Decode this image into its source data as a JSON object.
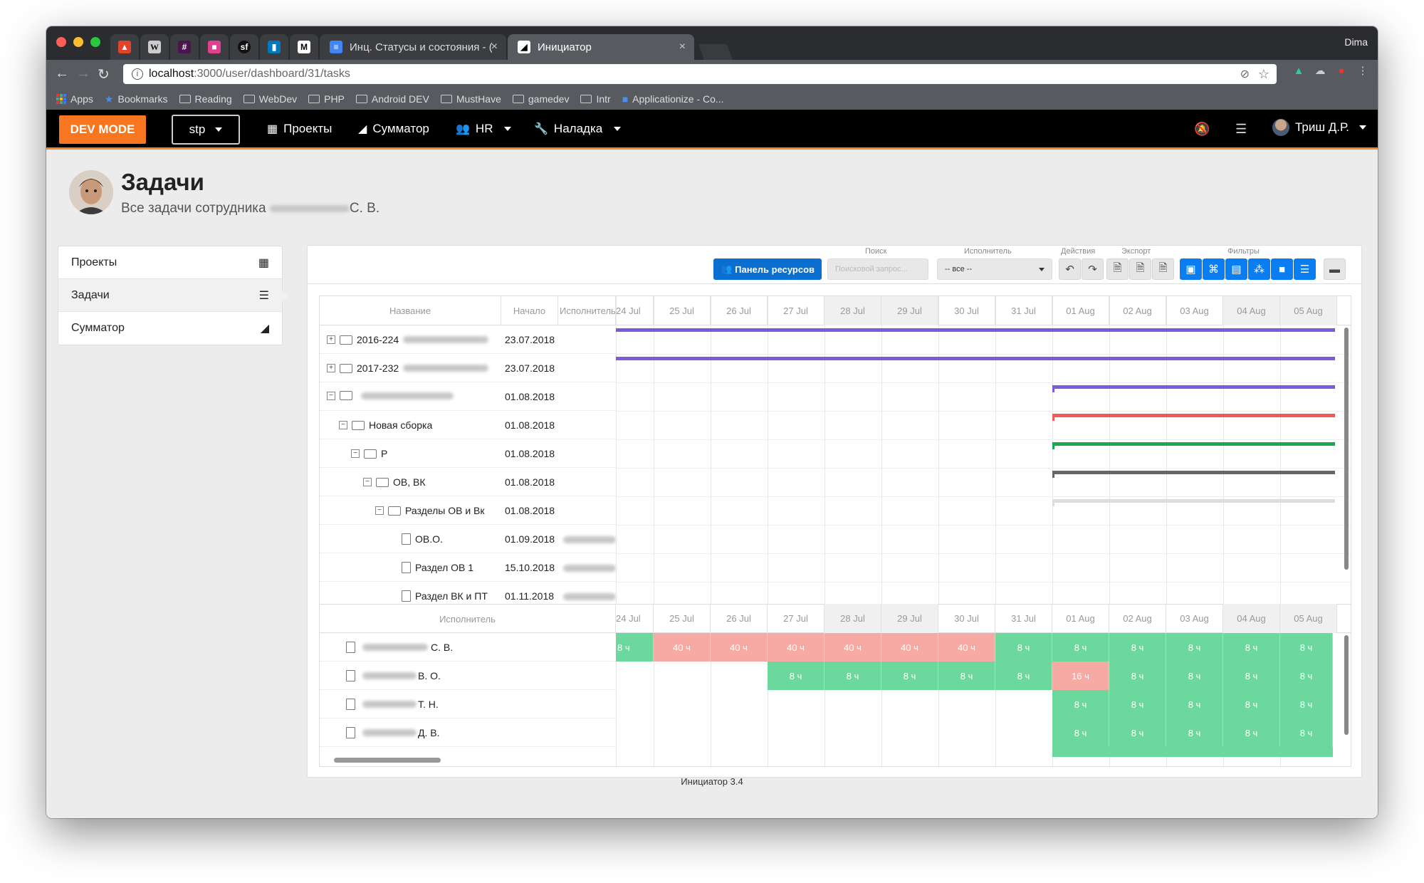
{
  "browser": {
    "tabs": [
      {
        "label": "Инц. Статусы и состояния - ("
      },
      {
        "label": "Инициатор"
      }
    ],
    "user_label": "Dima",
    "url_host": "localhost",
    "url_path": ":3000/user/dashboard/31/tasks",
    "bookmarks": [
      "Apps",
      "Bookmarks",
      "Reading",
      "WebDev",
      "PHP",
      "Android DEV",
      "MustHave",
      "gamedev",
      "Intr",
      "Applicationize - Co..."
    ]
  },
  "navbar": {
    "dev_mode": "DEV MODE",
    "project": "stp",
    "items": [
      "Проекты",
      "Сумматор",
      "HR",
      "Наладка"
    ],
    "user": "Триш Д.Р."
  },
  "page": {
    "title": "Задачи",
    "subtitle_prefix": "Все задачи сотрудника",
    "subtitle_suffix": "С. В."
  },
  "sidebar": {
    "items": [
      "Проекты",
      "Задачи",
      "Сумматор"
    ]
  },
  "toolbar": {
    "resources_button": "Панель ресурсов",
    "search_label": "Поиск",
    "search_placeholder": "Поисковой запрос...",
    "executor_label": "Исполнитель",
    "executor_value": "-- все --",
    "actions_label": "Действия",
    "export_label": "Экспорт",
    "filters_label": "Фильтры"
  },
  "gantt": {
    "headers": {
      "name": "Название",
      "start": "Начало",
      "executor": "Исполнитель"
    },
    "dates": [
      "24 Jul",
      "25 Jul",
      "26 Jul",
      "27 Jul",
      "28 Jul",
      "29 Jul",
      "30 Jul",
      "31 Jul",
      "01 Aug",
      "02 Aug",
      "03 Aug",
      "04 Aug",
      "05 Aug"
    ],
    "weekend_dates": [
      "28 Jul",
      "29 Jul",
      "04 Aug",
      "05 Aug"
    ],
    "tasks": [
      {
        "name": "2016-224",
        "start": "23.07.2018",
        "color": "#7b5cd6"
      },
      {
        "name": "2017-232",
        "start": "23.07.2018",
        "color": "#7b5cd6"
      },
      {
        "name": "",
        "start": "01.08.2018",
        "color": "#7b5cd6"
      },
      {
        "name": "Новая сборка",
        "start": "01.08.2018",
        "color": "#f05a5a"
      },
      {
        "name": "Р",
        "start": "01.08.2018",
        "color": "#1aa84f"
      },
      {
        "name": "ОВ, ВК",
        "start": "01.08.2018",
        "color": "#666666"
      },
      {
        "name": "Разделы ОВ и Вк",
        "start": "01.08.2018",
        "color": "#dddddd"
      },
      {
        "name": "ОВ.О.",
        "start": "01.09.2018"
      },
      {
        "name": "Раздел ОВ 1",
        "start": "15.10.2018"
      },
      {
        "name": "Раздел ВК и ПТ",
        "start": "01.11.2018"
      }
    ],
    "resource_header": "Исполнитель",
    "resources": [
      {
        "name": "С. В.",
        "hours": [
          "8 ч",
          "40 ч",
          "40 ч",
          "40 ч",
          "40 ч",
          "40 ч",
          "40 ч",
          "8 ч",
          "8 ч",
          "8 ч",
          "8 ч",
          "8 ч",
          "8 ч"
        ]
      },
      {
        "name": "В. О.",
        "hours": [
          "",
          "",
          "",
          "8 ч",
          "8 ч",
          "8 ч",
          "8 ч",
          "8 ч",
          "16 ч",
          "8 ч",
          "8 ч",
          "8 ч",
          "8 ч"
        ]
      },
      {
        "name": "Т. Н.",
        "hours": [
          "",
          "",
          "",
          "",
          "",
          "",
          "",
          "",
          "8 ч",
          "8 ч",
          "8 ч",
          "8 ч",
          "8 ч"
        ]
      },
      {
        "name": "Д. В.",
        "hours": [
          "",
          "",
          "",
          "",
          "",
          "",
          "",
          "",
          "8 ч",
          "8 ч",
          "8 ч",
          "8 ч",
          "8 ч"
        ]
      }
    ]
  },
  "footer": {
    "version": "Инициатор 3.4"
  }
}
